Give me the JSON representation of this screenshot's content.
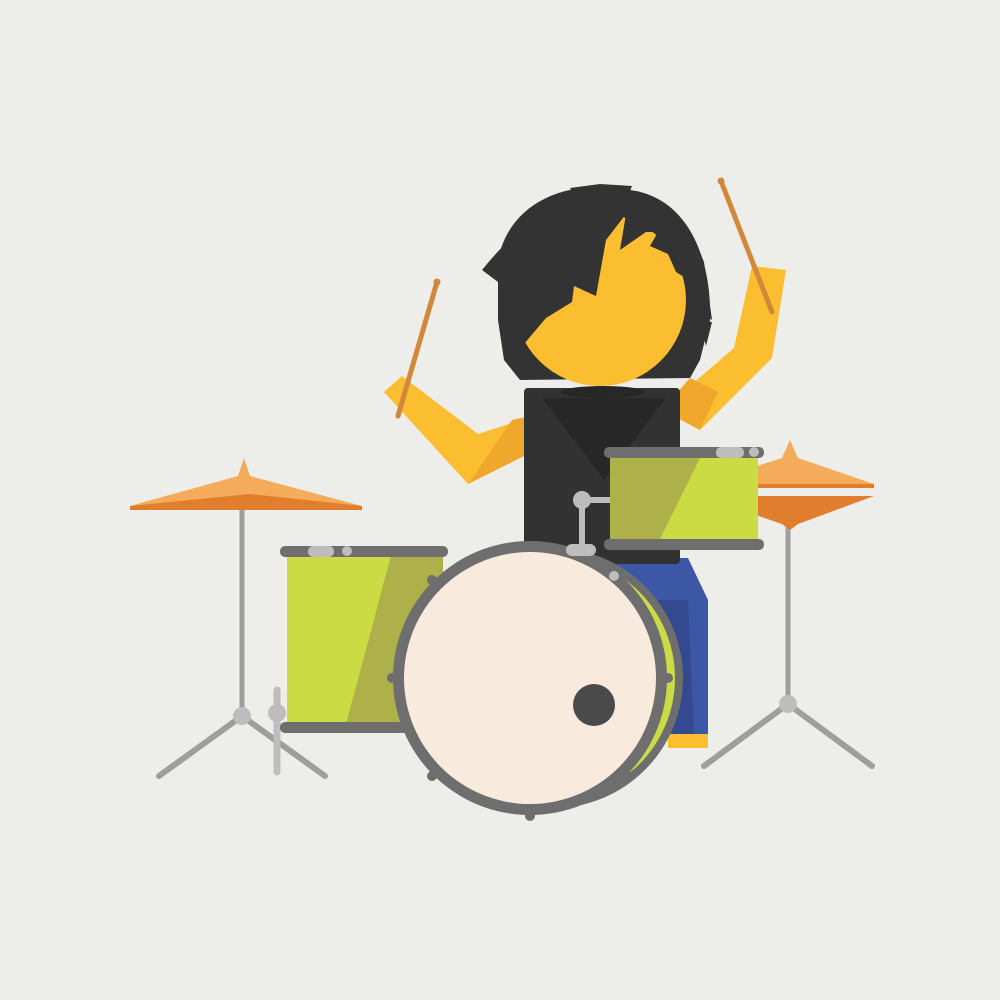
{
  "scene": {
    "subject": "drummer",
    "colors": {
      "background": "#EDEDE9",
      "skin": "#FBBE30",
      "skin_shadow": "#F0A82C",
      "hair": "#333333",
      "shirt": "#323232",
      "jeans": "#3D57A7",
      "drum_shell": "#CBDB44",
      "drum_shell_shade": "#AEB04A",
      "rim": "#6E6E6E",
      "bass_drum_head": "#F8EBDE",
      "bass_port": "#4A4A4A",
      "cymbal_top": "#F4AC5A",
      "cymbal_bottom": "#E07E2E",
      "stand": "#9E9E9E",
      "stand_joint": "#BDBDBD",
      "drumstick": "#D2883A"
    },
    "elements": [
      "drummer-figure",
      "hair",
      "drumsticks",
      "left-cymbal",
      "right-cymbal",
      "floor-tom",
      "rack-tom",
      "bass-drum"
    ]
  }
}
